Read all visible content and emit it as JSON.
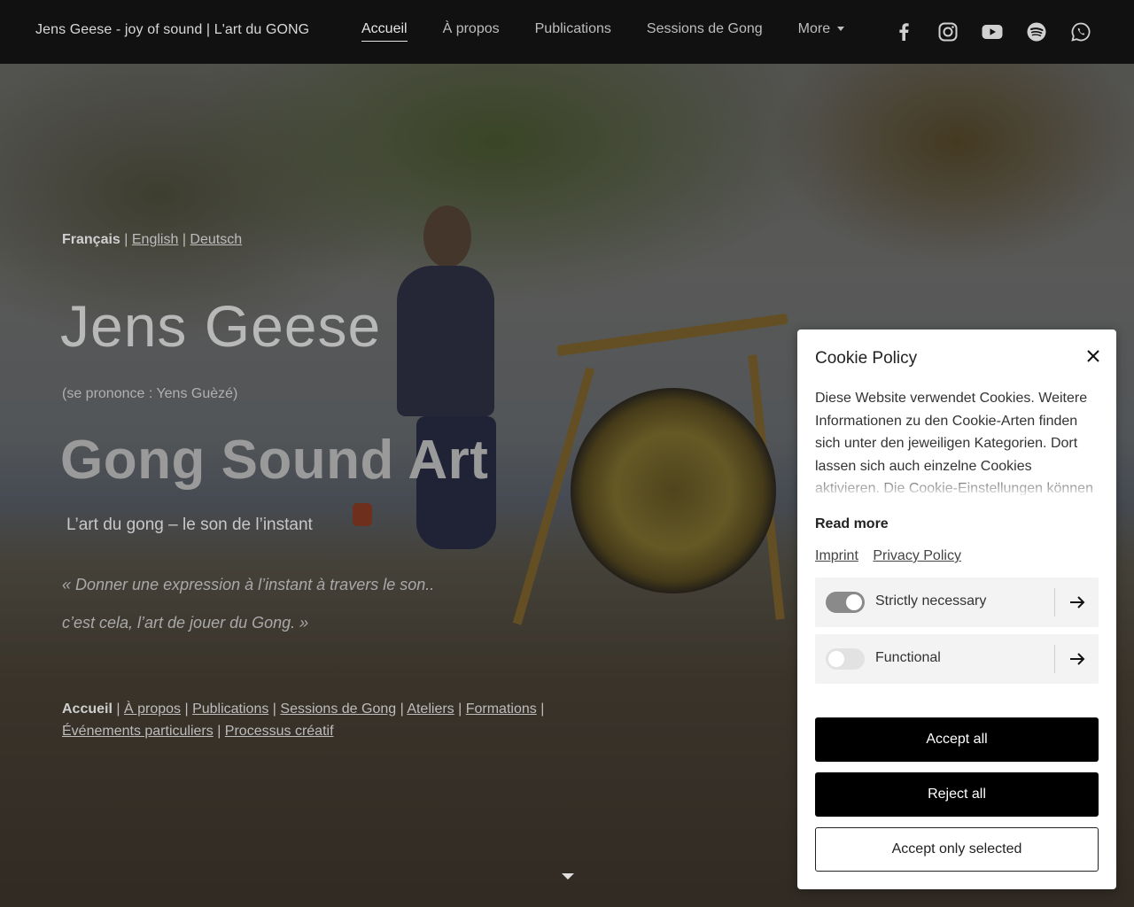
{
  "nav": {
    "brand": "Jens Geese - joy of sound | L'art du GONG",
    "links": [
      "Accueil",
      "À propos",
      "Publications",
      "Sessions de Gong",
      "More"
    ],
    "social": [
      "facebook-icon",
      "instagram-icon",
      "youtube-icon",
      "spotify-icon",
      "whatsapp-icon"
    ]
  },
  "hero": {
    "lang_current": "Français",
    "lang_en": "English",
    "lang_de": "Deutsch",
    "sep": "|",
    "name": "Jens Geese",
    "pronunciation": "(se prononce : Yens Guèzé)",
    "title": "Gong Sound Art",
    "subtitle": "L’art du gong – le son de l’instant",
    "quote_line1": "« Donner une expression à l’instant à travers le son..",
    "quote_line2": "c’est cela, l’art de jouer du Gong. »"
  },
  "footer_links": {
    "current": "Accueil",
    "items": [
      "À propos",
      "Publications",
      "Sessions de Gong",
      "Ateliers",
      "Formations",
      "Événements particuliers",
      "Processus créatif"
    ]
  },
  "cookie": {
    "title": "Cookie Policy",
    "text": "Diese Website verwendet Cookies. Weitere Informationen zu den Cookie-Arten finden sich unter den jeweiligen Kategorien. Dort lassen sich auch einzelne Cookies aktivieren. Die Cookie-Einstellungen können jederzeit",
    "read_more": "Read more",
    "imprint": "Imprint",
    "privacy": "Privacy Policy",
    "categories": [
      {
        "label": "Strictly necessary",
        "enabled": true
      },
      {
        "label": "Functional",
        "enabled": false
      }
    ],
    "accept_all": "Accept all",
    "reject_all": "Reject all",
    "accept_selected": "Accept only selected"
  }
}
